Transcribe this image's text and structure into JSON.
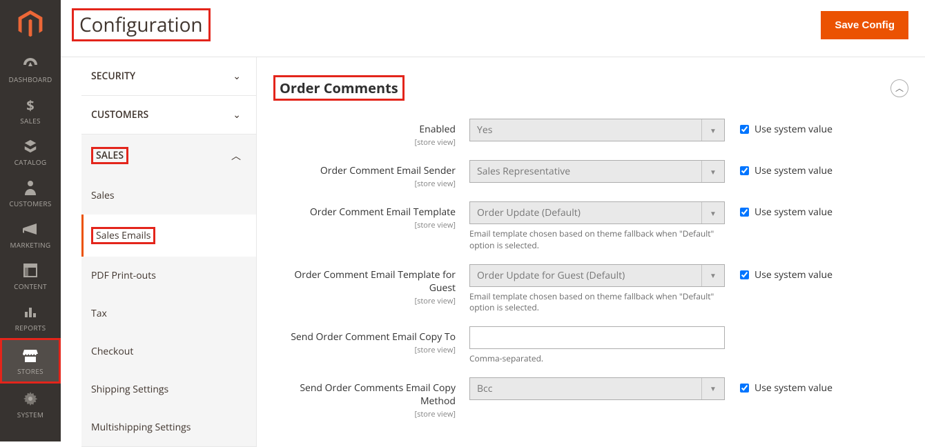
{
  "header": {
    "page_title": "Configuration",
    "save_button": "Save Config"
  },
  "nav": {
    "items": [
      {
        "id": "dashboard",
        "label": "DASHBOARD",
        "icon": "dashboard-icon"
      },
      {
        "id": "sales",
        "label": "SALES",
        "icon": "dollar-icon"
      },
      {
        "id": "catalog",
        "label": "CATALOG",
        "icon": "catalog-icon"
      },
      {
        "id": "customers",
        "label": "CUSTOMERS",
        "icon": "customers-icon"
      },
      {
        "id": "marketing",
        "label": "MARKETING",
        "icon": "marketing-icon"
      },
      {
        "id": "content",
        "label": "CONTENT",
        "icon": "content-icon"
      },
      {
        "id": "reports",
        "label": "REPORTS",
        "icon": "reports-icon"
      },
      {
        "id": "stores",
        "label": "STORES",
        "icon": "stores-icon",
        "active": true
      },
      {
        "id": "system",
        "label": "SYSTEM",
        "icon": "system-icon"
      }
    ]
  },
  "sidebar": {
    "groups": [
      {
        "label": "SECURITY",
        "expanded": false
      },
      {
        "label": "CUSTOMERS",
        "expanded": false
      },
      {
        "label": "SALES",
        "expanded": true
      }
    ],
    "sales_items": [
      {
        "label": "Sales"
      },
      {
        "label": "Sales Emails",
        "active": true
      },
      {
        "label": "PDF Print-outs"
      },
      {
        "label": "Tax"
      },
      {
        "label": "Checkout"
      },
      {
        "label": "Shipping Settings"
      },
      {
        "label": "Multishipping Settings"
      }
    ]
  },
  "section": {
    "title": "Order Comments"
  },
  "fields": {
    "enabled": {
      "label": "Enabled",
      "scope": "[store view]",
      "value": "Yes",
      "use_system": "Use system value",
      "checked": true,
      "disabled": true
    },
    "sender": {
      "label": "Order Comment Email Sender",
      "scope": "[store view]",
      "value": "Sales Representative",
      "use_system": "Use system value",
      "checked": true,
      "disabled": true
    },
    "template": {
      "label": "Order Comment Email Template",
      "scope": "[store view]",
      "value": "Order Update (Default)",
      "use_system": "Use system value",
      "checked": true,
      "disabled": true,
      "note": "Email template chosen based on theme fallback when \"Default\" option is selected."
    },
    "template_guest": {
      "label": "Order Comment Email Template for Guest",
      "scope": "[store view]",
      "value": "Order Update for Guest (Default)",
      "use_system": "Use system value",
      "checked": true,
      "disabled": true,
      "note": "Email template chosen based on theme fallback when \"Default\" option is selected."
    },
    "copy_to": {
      "label": "Send Order Comment Email Copy To",
      "scope": "[store view]",
      "value": "",
      "note": "Comma-separated."
    },
    "copy_method": {
      "label": "Send Order Comments Email Copy Method",
      "scope": "[store view]",
      "value": "Bcc",
      "use_system": "Use system value",
      "checked": true,
      "disabled": true
    }
  }
}
